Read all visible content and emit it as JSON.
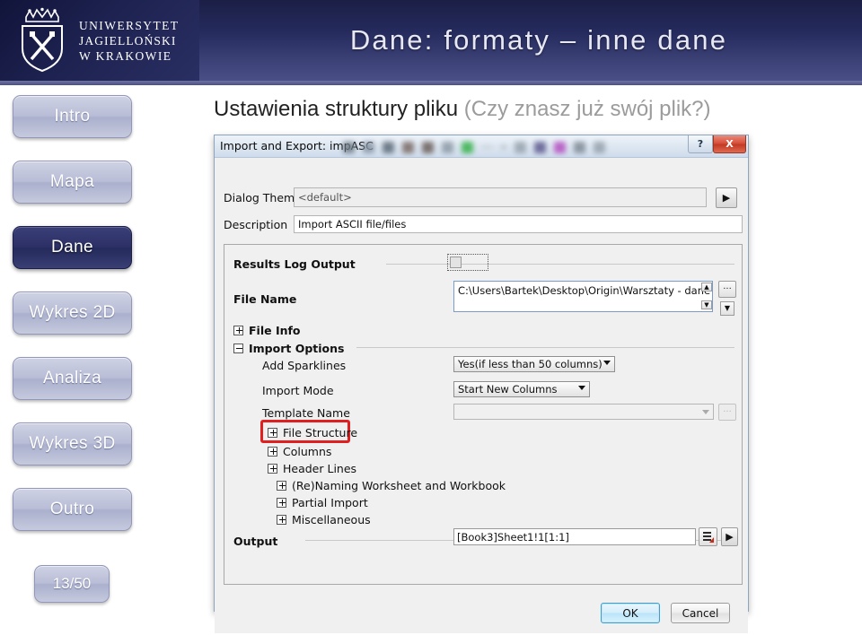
{
  "header": {
    "title": "Dane: formaty – inne dane",
    "logo_lines": [
      "UNIWERSYTET",
      "JAGIELLOŃSKI",
      "W KRAKOWIE"
    ],
    "brand_color": "#242a5c"
  },
  "sidebar": {
    "items": [
      {
        "label": "Intro",
        "active": false
      },
      {
        "label": "Mapa",
        "active": false
      },
      {
        "label": "Dane",
        "active": true
      },
      {
        "label": "Wykres 2D",
        "active": false
      },
      {
        "label": "Analiza",
        "active": false
      },
      {
        "label": "Wykres 3D",
        "active": false
      },
      {
        "label": "Outro",
        "active": false
      }
    ],
    "page_counter": "13/50"
  },
  "content": {
    "heading_main": "Ustawienia struktury pliku",
    "heading_sub": "(Czy znasz już swój plik?)"
  },
  "dialog": {
    "title": "Import and Export: impASC",
    "help_glyph": "?",
    "close_glyph": "X",
    "theme": {
      "label": "Dialog Theme",
      "value": "<default>",
      "arrow_glyph": "▶"
    },
    "description": {
      "label": "Description",
      "value": "Import ASCII file/files"
    },
    "results_log": {
      "label": "Results Log Output",
      "checked": false
    },
    "file_name": {
      "label": "File Name",
      "value": "C:\\Users\\Bartek\\Desktop\\Origin\\Warsztaty - dane wsado",
      "browse_glyph": "...",
      "up_glyph": "▲",
      "down_glyph": "▼",
      "dropdown_glyph": "▼"
    },
    "file_info": {
      "label": "File Info",
      "expanded": false,
      "glyph": "+"
    },
    "import_options": {
      "label": "Import Options",
      "expanded": true,
      "glyph": "−",
      "add_sparklines": {
        "label": "Add Sparklines",
        "value": "Yes(if less than 50 columns)"
      },
      "import_mode": {
        "label": "Import Mode",
        "value": "Start New Columns"
      },
      "template_name": {
        "label": "Template Name",
        "value": "",
        "browse_glyph": "..."
      },
      "tree_nodes": [
        {
          "label": "File Structure",
          "glyph": "+",
          "highlighted": true
        },
        {
          "label": "Columns",
          "glyph": "+",
          "highlighted": false
        },
        {
          "label": "Header Lines",
          "glyph": "+",
          "highlighted": false
        },
        {
          "label": "(Re)Naming Worksheet and Workbook",
          "glyph": "+",
          "highlighted": false
        },
        {
          "label": "Partial Import",
          "glyph": "+",
          "highlighted": false
        },
        {
          "label": "Miscellaneous",
          "glyph": "+",
          "highlighted": false
        }
      ],
      "highlight_color": "#e02020"
    },
    "output": {
      "label": "Output",
      "value": "[Book3]Sheet1!1[1:1]",
      "arrow_glyph": "▶"
    },
    "buttons": {
      "ok": "OK",
      "cancel": "Cancel"
    }
  }
}
